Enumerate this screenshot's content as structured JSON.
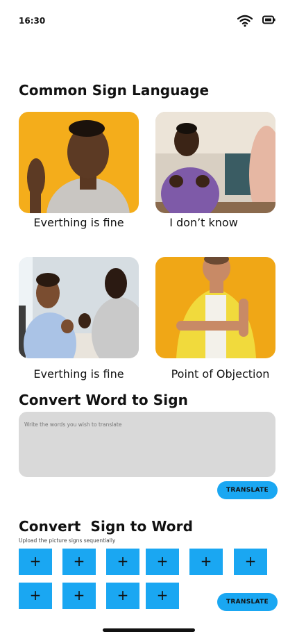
{
  "status": {
    "time": "16:30"
  },
  "common": {
    "title": "Common Sign Language",
    "cards": [
      {
        "caption": "Everthing is fine"
      },
      {
        "caption": "I don’t know"
      },
      {
        "caption": "Everthing is fine"
      },
      {
        "caption": "Point of Objection"
      }
    ]
  },
  "word_to_sign": {
    "title": "Convert Word to Sign",
    "placeholder": "Write the words you wish to translate",
    "button": "TRANSLATE"
  },
  "sign_to_word": {
    "title": "Convert  Sign to Word",
    "subtitle": "Upload the picture signs sequentially",
    "upload_symbol": "+",
    "button": "TRANSLATE"
  },
  "colors": {
    "accent": "#1aa7f2",
    "input_bg": "#d9d9d9"
  }
}
